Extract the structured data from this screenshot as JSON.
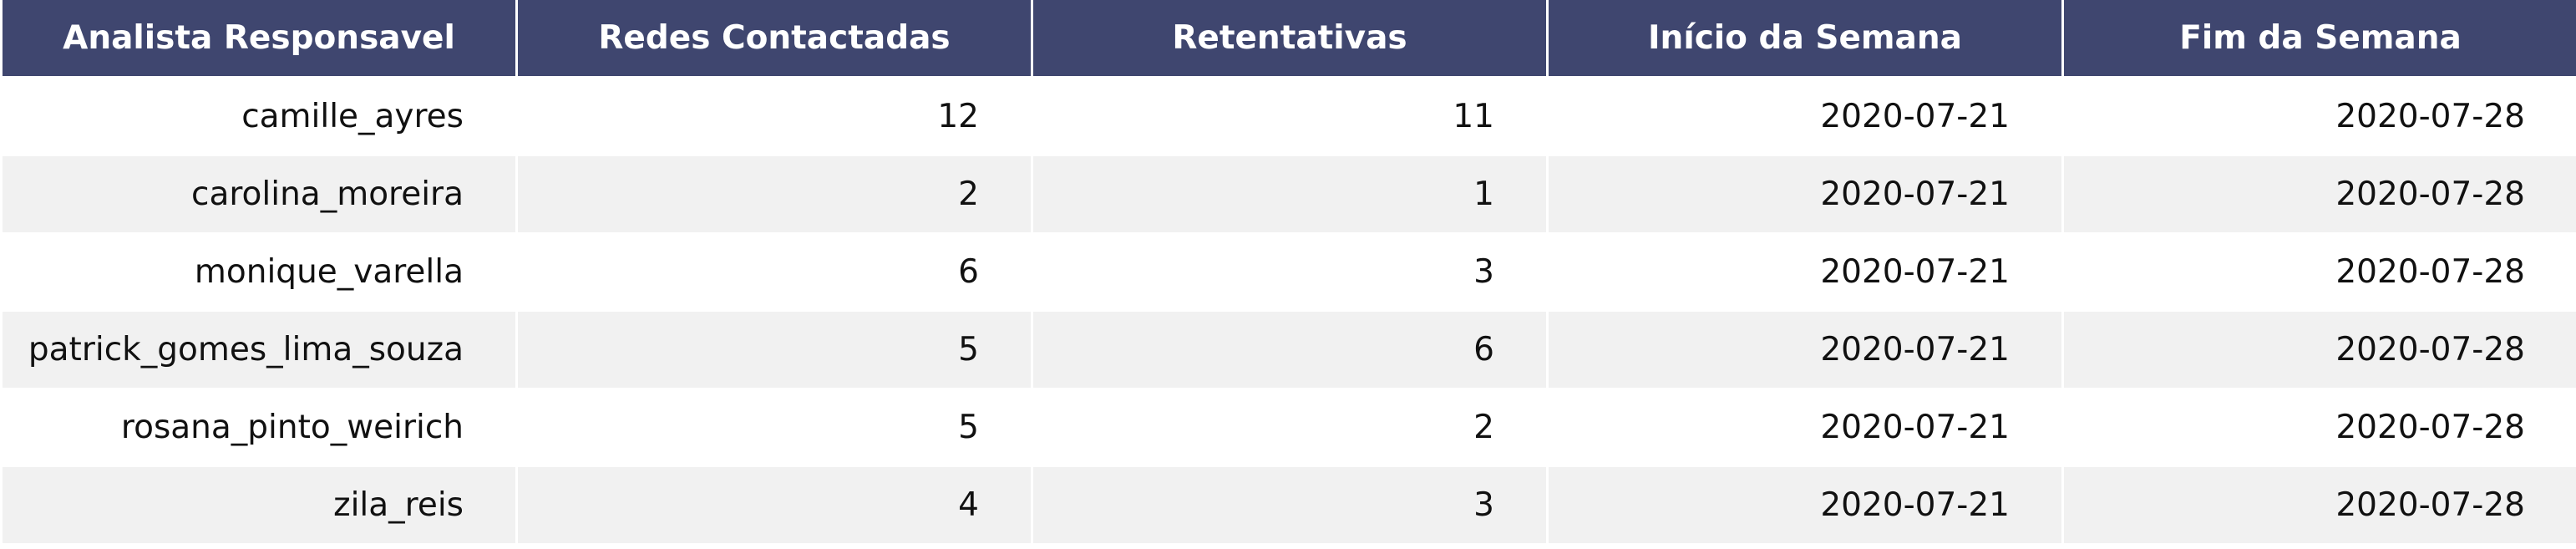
{
  "chart_data": {
    "type": "table",
    "columns": [
      "Analista Responsavel",
      "Redes Contactadas",
      "Retentativas",
      "Início da Semana",
      "Fim da Semana"
    ],
    "rows": [
      [
        "camille_ayres",
        "12",
        "11",
        "2020-07-21",
        "2020-07-28"
      ],
      [
        "carolina_moreira",
        "2",
        "1",
        "2020-07-21",
        "2020-07-28"
      ],
      [
        "monique_varella",
        "6",
        "3",
        "2020-07-21",
        "2020-07-28"
      ],
      [
        "patrick_gomes_lima_souza",
        "5",
        "6",
        "2020-07-21",
        "2020-07-28"
      ],
      [
        "rosana_pinto_weirich",
        "5",
        "2",
        "2020-07-21",
        "2020-07-28"
      ],
      [
        "zila_reis",
        "4",
        "3",
        "2020-07-21",
        "2020-07-28"
      ]
    ],
    "colors": {
      "header_bg": "#3f466f",
      "header_text": "#ffffff",
      "row_alt_bg": "#f1f1f1"
    }
  }
}
